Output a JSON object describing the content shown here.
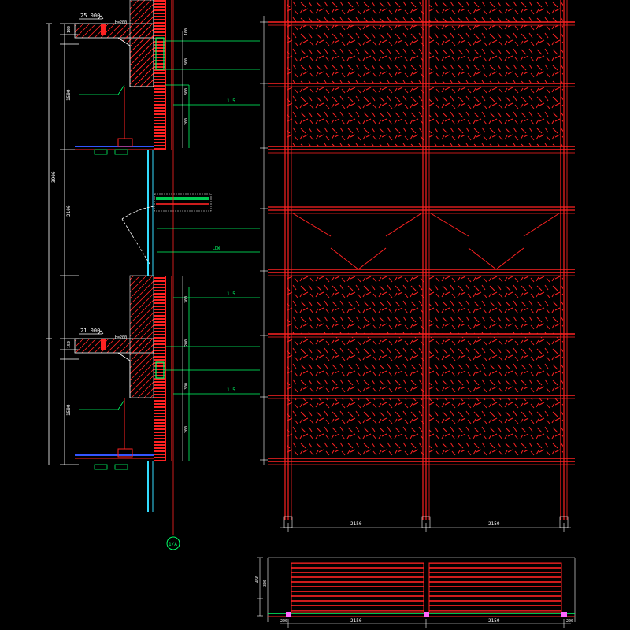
{
  "section": {
    "level_top": "25.000",
    "level_top_note": "H=200",
    "level_mid": "21.000",
    "level_mid_note": "H=200",
    "dim_overall": "3900",
    "dim_parapet_upper": "1500",
    "dim_window": "2100",
    "dim_parapet_lower": "1500",
    "dim_small_a": "100",
    "dim_small_b": "200",
    "dim_small_c": "150",
    "note_finish_upper": "1.5",
    "note_finish_mid": "1.5",
    "note_finish_lower": "1.5",
    "note_louver": "LDW",
    "section_mark": "1/A",
    "right_dims_upper": [
      "100",
      "300",
      "300",
      "200"
    ],
    "right_dims_lower": [
      "300",
      "200",
      "300",
      "200"
    ]
  },
  "elevation": {
    "bay_dim_left": "2150",
    "bay_dim_right": "2150"
  },
  "plan": {
    "dim_left": "200",
    "dim_bay_left": "2150",
    "dim_bay_right": "2150",
    "dim_right": "200",
    "dim_height_a": "450",
    "dim_height_b": "300"
  },
  "colors": {
    "background": "#000000",
    "structure": "#ff2222",
    "annotation": "#00ff66",
    "glass": "#33ddff",
    "dimension": "#ffffff",
    "brace": "#ff66ff"
  }
}
